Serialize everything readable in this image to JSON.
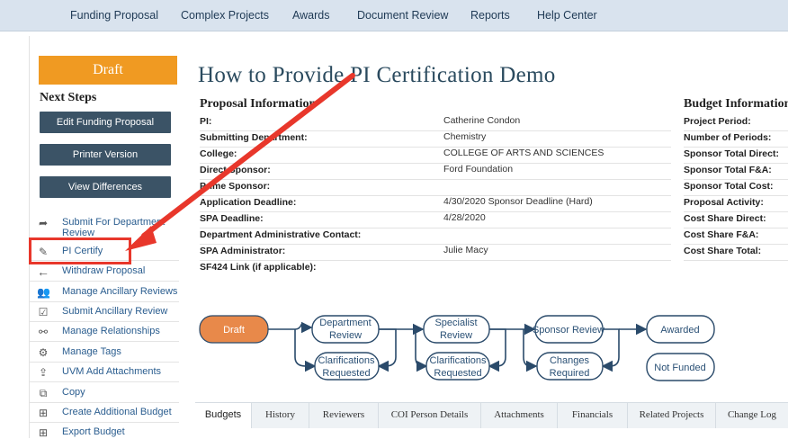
{
  "topnav": {
    "items": [
      "Funding Proposal",
      "Complex Projects",
      "Awards",
      "Document Review",
      "Reports",
      "Help Center"
    ]
  },
  "status": "Draft",
  "next_steps": {
    "heading": "Next Steps",
    "buttons": [
      "Edit Funding Proposal",
      "Printer Version",
      "View Differences"
    ],
    "activities": [
      {
        "icon": "share-arrow-icon",
        "label": "Submit For Department Review"
      },
      {
        "icon": "edit-icon",
        "label": "PI Certify"
      },
      {
        "icon": "arrow-left-icon",
        "label": "Withdraw Proposal"
      },
      {
        "icon": "users-icon",
        "label": "Manage Ancillary Reviews"
      },
      {
        "icon": "checkbox-icon",
        "label": "Submit Ancillary Review"
      },
      {
        "icon": "link-icon",
        "label": "Manage Relationships"
      },
      {
        "icon": "gear-icon",
        "label": "Manage Tags"
      },
      {
        "icon": "upload-icon",
        "label": "UVM Add Attachments"
      },
      {
        "icon": "copy-icon",
        "label": "Copy"
      },
      {
        "icon": "add-document-icon",
        "label": "Create Additional Budget"
      },
      {
        "icon": "export-icon",
        "label": "Export Budget"
      }
    ]
  },
  "page_title": "How to Provide PI Certification Demo",
  "proposal_info": {
    "heading": "Proposal Information",
    "rows": [
      {
        "label": "PI:",
        "value": "Catherine  Condon"
      },
      {
        "label": "Submitting Department:",
        "value": "Chemistry"
      },
      {
        "label": "College:",
        "value": "COLLEGE OF ARTS AND SCIENCES"
      },
      {
        "label": "Direct Sponsor:",
        "value": "Ford Foundation"
      },
      {
        "label": "Prime Sponsor:",
        "value": ""
      },
      {
        "label": "Application Deadline:",
        "value": "4/30/2020  Sponsor Deadline (Hard)"
      },
      {
        "label": "SPA Deadline:",
        "value": "4/28/2020"
      },
      {
        "label": "Department Administrative Contact:",
        "value": ""
      },
      {
        "label": "SPA Administrator:",
        "value": "Julie  Macy"
      },
      {
        "label": "SF424 Link (if applicable):",
        "value": ""
      }
    ]
  },
  "budget_info": {
    "heading": "Budget Information",
    "rows": [
      "Project Period:",
      "Number of Periods:",
      "Sponsor Total Direct:",
      "Sponsor Total F&A:",
      "Sponsor Total Cost:",
      "Proposal Activity:",
      "Cost Share Direct:",
      "Cost Share F&A:",
      "Cost Share Total:"
    ]
  },
  "workflow": {
    "states": {
      "draft": "Draft",
      "department_review": [
        "Department",
        "Review"
      ],
      "clar1": [
        "Clarifications",
        "Requested"
      ],
      "specialist_review": [
        "Specialist",
        "Review"
      ],
      "clar2": [
        "Clarifications",
        "Requested"
      ],
      "sponsor_review": "Sponsor Review",
      "changes_required": [
        "Changes",
        "Required"
      ],
      "awarded": "Awarded",
      "not_funded": "Not Funded"
    },
    "current_state_color": "#e8894a"
  },
  "tabs": [
    "Budgets",
    "History",
    "Reviewers",
    "COI Person Details",
    "Attachments",
    "Financials",
    "Related Projects",
    "Change Log"
  ],
  "colors": {
    "nav_bg": "#d9e3ee",
    "status_orange": "#f09a22",
    "button_dark": "#3b5366",
    "link_blue": "#2a5d8f",
    "annotation_red": "#e8372b",
    "title": "#2a4a5e"
  }
}
